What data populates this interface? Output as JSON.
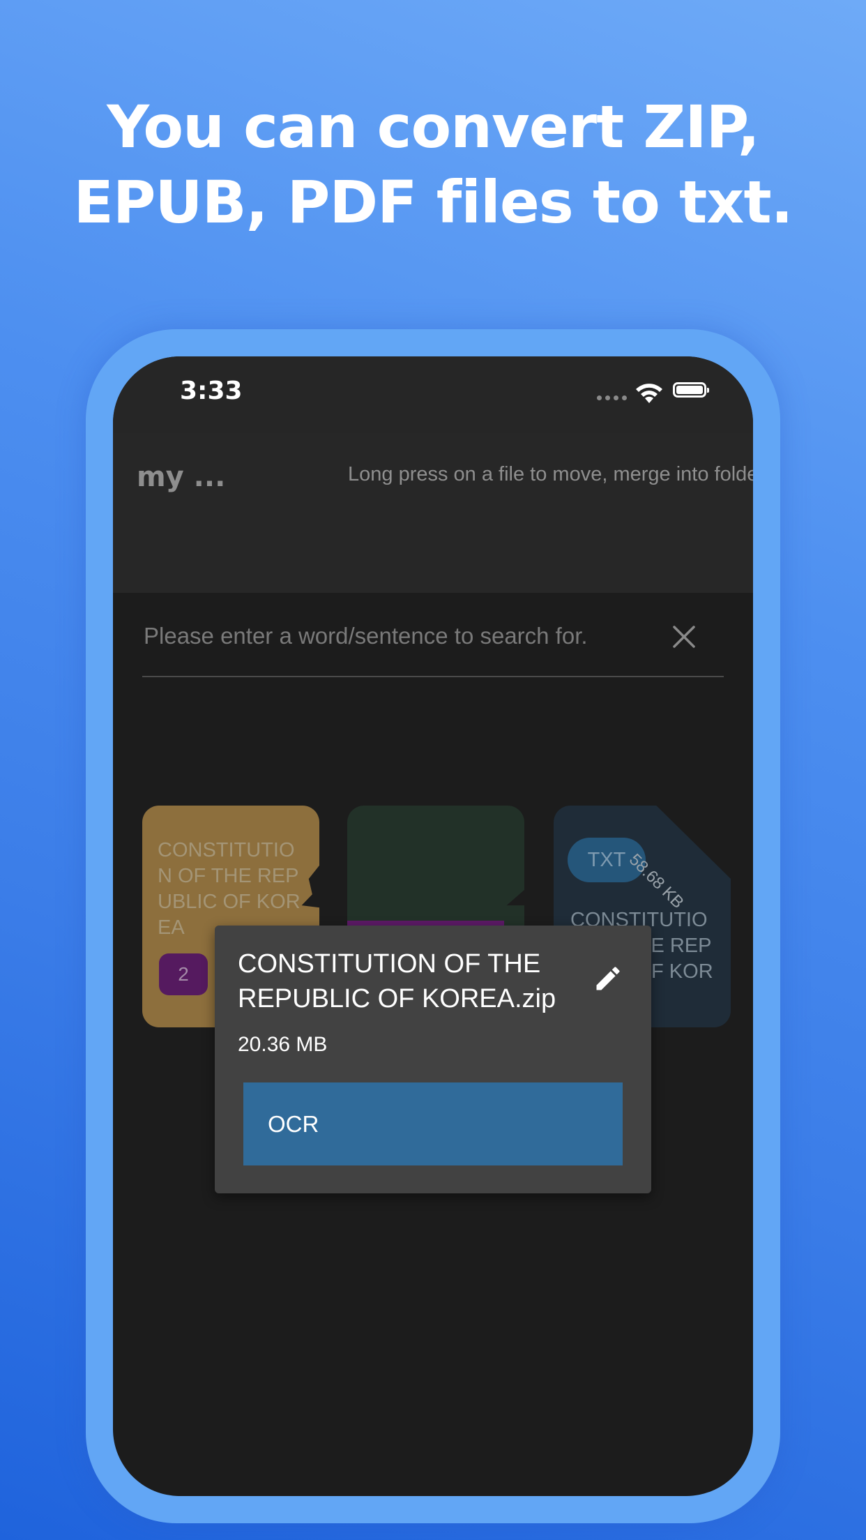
{
  "headline": {
    "line1": "You can convert ZIP,",
    "line2": "EPUB, PDF files to txt."
  },
  "status_bar": {
    "time": "3:33",
    "icons": [
      "signal-icon",
      "wifi-icon",
      "battery-icon"
    ]
  },
  "app_bar": {
    "title": "my ...",
    "hint": "Long press on a file to move, merge into folder."
  },
  "search": {
    "placeholder": "Please enter a word/sentence to search for.",
    "clear_icon": "close-icon"
  },
  "cards": [
    {
      "title": "CONSTITUTION OF THE REPUBLIC OF KOREA",
      "badge": "2",
      "color": "#8d6f3d"
    },
    {
      "title": "",
      "color": "#223128"
    },
    {
      "title": "CONSTITUTION OF THE REPUBLIC OF KOREA.txt",
      "type": "TXT",
      "size": "58.68 KB",
      "color": "#1f2c38"
    }
  ],
  "popup": {
    "title": "CONSTITUTION OF THE REPUBLIC OF KOREA.zip",
    "size": "20.36 MB",
    "action": "OCR",
    "edit_icon": "pencil-icon"
  },
  "colors": {
    "accent": "#306b9a",
    "phone_frame": "#62a6f5",
    "screen_bg": "#1c1c1c"
  }
}
